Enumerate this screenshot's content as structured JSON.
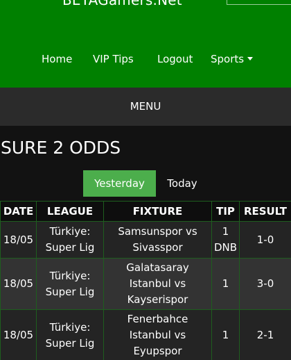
{
  "site": {
    "brand": "BETAGamers.Net"
  },
  "nav": {
    "items": [
      "Home",
      "VIP Tips",
      "Logout",
      "Sports"
    ]
  },
  "menu": {
    "label": "MENU"
  },
  "page": {
    "title": "SURE 2 ODDS"
  },
  "tabs": [
    {
      "label": "Yesterday",
      "active": true
    },
    {
      "label": "Today",
      "active": false
    }
  ],
  "table": {
    "headers": [
      "DATE",
      "LEAGUE",
      "FIXTURE",
      "TIP",
      "RESULT"
    ],
    "rows": [
      {
        "date": "18/05",
        "league": "Türkiye: Super Lig",
        "fixture": "Samsunspor vs Sivasspor",
        "tip": "1 DNB",
        "result": "1-0"
      },
      {
        "date": "18/05",
        "league": "Türkiye: Super Lig",
        "fixture": "Galatasaray Istanbul vs Kayserispor",
        "tip": "1",
        "result": "3-0"
      },
      {
        "date": "18/05",
        "league": "Türkiye: Super Lig",
        "fixture": "Fenerbahce Istanbul vs Eyupspor",
        "tip": "1",
        "result": "2-1"
      }
    ]
  },
  "colors": {
    "header_green": "#008000",
    "tab_active": "#4cae4c",
    "menu_bar": "#2b2b2b",
    "background": "#121212"
  }
}
